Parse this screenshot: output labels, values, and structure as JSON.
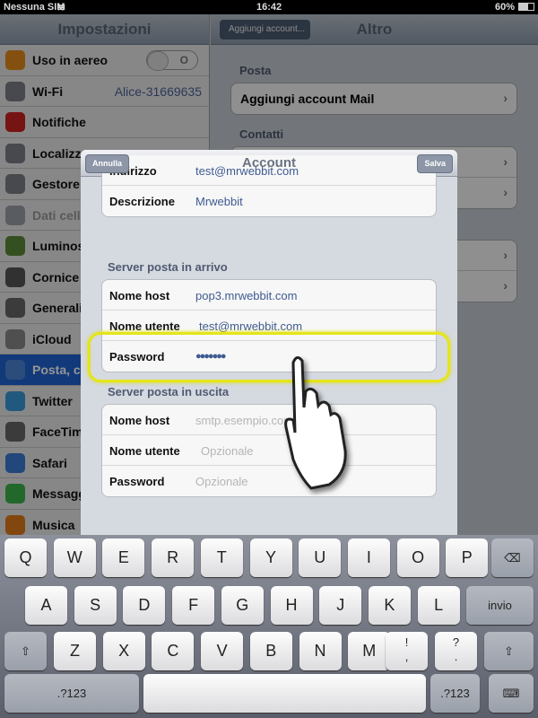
{
  "status": {
    "carrier": "Nessuna SIM",
    "time": "16:42",
    "battery": "60%"
  },
  "sidebar": {
    "title": "Impostazioni",
    "items": [
      {
        "label": "Uso in aereo",
        "icon": "airplane-icon",
        "color": "#e38a1a",
        "toggle": "O"
      },
      {
        "label": "Wi-Fi",
        "icon": "wifi-icon",
        "color": "#7a7f88",
        "value": "Alice-31669635"
      },
      {
        "label": "Notifiche",
        "icon": "notifications-icon",
        "color": "#c22"
      },
      {
        "label": "Localizz",
        "icon": "location-icon",
        "color": "#7a7f88"
      },
      {
        "label": "Gestore",
        "icon": "phone-icon",
        "color": "#7a7f88"
      },
      {
        "label": "Dati cell",
        "icon": "antenna-icon",
        "color": "#9aa0aa"
      },
      {
        "label": "Luminos",
        "icon": "brightness-icon",
        "color": "#5a8a3a"
      },
      {
        "label": "Cornice",
        "icon": "picture-frame-icon",
        "color": "#555"
      },
      {
        "label": "Generali",
        "icon": "gear-icon",
        "color": "#666"
      },
      {
        "label": "iCloud",
        "icon": "cloud-icon",
        "color": "#888"
      },
      {
        "label": "Posta, c",
        "icon": "mail-icon",
        "color": "#4a86d6",
        "selected": true
      },
      {
        "label": "Twitter",
        "icon": "twitter-icon",
        "color": "#3a9ad9"
      },
      {
        "label": "FaceTim",
        "icon": "facetime-icon",
        "color": "#666"
      },
      {
        "label": "Safari",
        "icon": "safari-icon",
        "color": "#3a7bd5"
      },
      {
        "label": "Messagg",
        "icon": "messages-icon",
        "color": "#3bb34a"
      },
      {
        "label": "Musica",
        "icon": "music-icon",
        "color": "#e07a1a"
      }
    ]
  },
  "detail": {
    "back": "Aggiungi account...",
    "title": "Altro",
    "posta_label": "Posta",
    "add_mail": "Aggiungi account Mail",
    "contatti_label": "Contatti"
  },
  "modal": {
    "title": "Account",
    "cancel": "Annulla",
    "save": "Salva",
    "account": [
      {
        "label": "Indirizzo",
        "value": "test@mrwebbit.com"
      },
      {
        "label": "Descrizione",
        "value": "Mrwebbit"
      }
    ],
    "incoming_label": "Server posta in arrivo",
    "incoming": [
      {
        "label": "Nome host",
        "value": "pop3.mrwebbit.com"
      },
      {
        "label": "Nome utente",
        "value": "test@mrwebbit.com"
      },
      {
        "label": "Password",
        "value": "●●●●●●●"
      }
    ],
    "outgoing_label": "Server posta in uscita",
    "outgoing": [
      {
        "label": "Nome host",
        "placeholder": "smtp.esempio.com"
      },
      {
        "label": "Nome utente",
        "placeholder": "Opzionale"
      },
      {
        "label": "Password",
        "placeholder": "Opzionale"
      }
    ]
  },
  "keyboard": {
    "row1": [
      "Q",
      "W",
      "E",
      "R",
      "T",
      "Y",
      "U",
      "I",
      "O",
      "P"
    ],
    "row2": [
      "A",
      "S",
      "D",
      "F",
      "G",
      "H",
      "J",
      "K",
      "L"
    ],
    "row3": [
      "Z",
      "X",
      "C",
      "V",
      "B",
      "N",
      "M"
    ],
    "excl": "!\n,",
    "quest": "?\n.",
    "enter": "invio",
    "numbers": ".?123",
    "backspace_icon": "backspace-icon",
    "shift_icon": "shift-icon",
    "hide_icon": "keyboard-hide-icon"
  },
  "colors": {
    "highlight": "#e5e51a",
    "selected": "#1f62d1",
    "link": "#3f5b92"
  }
}
